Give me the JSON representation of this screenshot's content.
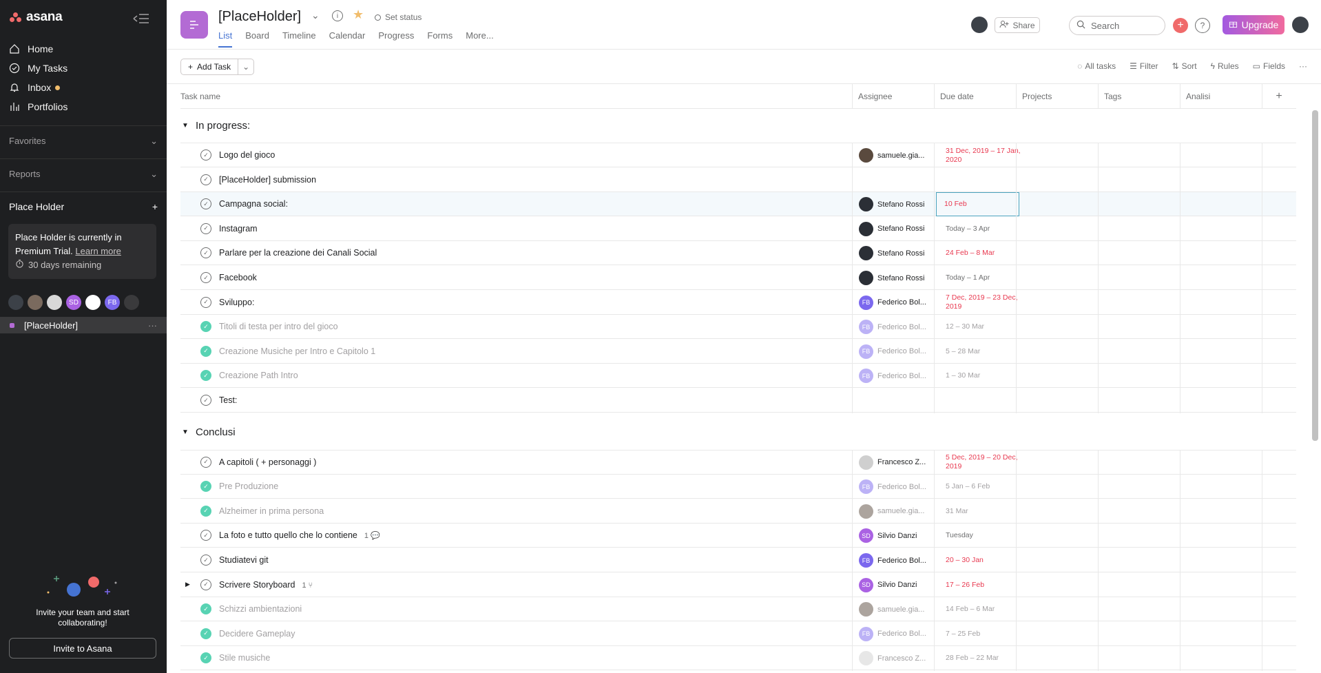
{
  "sidebar": {
    "logo_text": "asana",
    "nav": [
      {
        "label": "Home",
        "icon": "home-icon"
      },
      {
        "label": "My Tasks",
        "icon": "check-circle-icon"
      },
      {
        "label": "Inbox",
        "icon": "bell-icon"
      },
      {
        "label": "Portfolios",
        "icon": "bar-chart-icon"
      }
    ],
    "favorites_label": "Favorites",
    "reports_label": "Reports",
    "team_name": "Place Holder",
    "trial_text": "Place Holder is currently in Premium Trial.",
    "learn_more": "Learn more",
    "days_remaining": "30 days remaining",
    "members": [
      {
        "initials": "",
        "color": "#3c4148"
      },
      {
        "initials": "",
        "color": "#7a6a5e"
      },
      {
        "initials": "",
        "color": "#d8d8d8"
      },
      {
        "initials": "SD",
        "color": "#aa62e3"
      },
      {
        "initials": "",
        "color": "#ffffff"
      },
      {
        "initials": "FB",
        "color": "#7b68ee"
      },
      {
        "initials": "",
        "color": "#3a3a3c"
      }
    ],
    "project_name": "[PlaceHolder]",
    "project_more": "···",
    "invite_text_line1": "Invite your team and start",
    "invite_text_line2": "collaborating!",
    "invite_button": "Invite to Asana"
  },
  "header": {
    "project_title": "[PlaceHolder]",
    "set_status": "Set status",
    "tabs": [
      "List",
      "Board",
      "Timeline",
      "Calendar",
      "Progress",
      "Forms",
      "More..."
    ],
    "active_tab": "List",
    "share_label": "Share",
    "search_placeholder": "Search",
    "help_label": "?",
    "upgrade_label": "Upgrade"
  },
  "toolbar": {
    "add_task_label": "Add Task",
    "all_tasks_label": "All tasks",
    "filter_label": "Filter",
    "sort_label": "Sort",
    "rules_label": "Rules",
    "fields_label": "Fields",
    "more_label": "···"
  },
  "columns": [
    "Task name",
    "Assignee",
    "Due date",
    "Projects",
    "Tags",
    "Analisi"
  ],
  "add_column_label": "+",
  "sections": [
    {
      "title": "In progress:",
      "tasks": [
        {
          "name": "Logo del gioco",
          "done": false,
          "assignee": "samuele.gia...",
          "initials": "",
          "av_color": "#5a4a3e",
          "due": "31 Dec, 2019 – 17 Jan, 2020",
          "due_red": true
        },
        {
          "name": "[PlaceHolder] submission",
          "done": false,
          "assignee": "",
          "initials": "",
          "av_color": "",
          "due": "",
          "due_red": false
        },
        {
          "name": "Campagna social:",
          "done": false,
          "assignee": "Stefano Rossi",
          "initials": "",
          "av_color": "#2b2f36",
          "due": "10 Feb",
          "due_red": true,
          "selected": true
        },
        {
          "name": "Instagram",
          "done": false,
          "assignee": "Stefano Rossi",
          "initials": "",
          "av_color": "#2b2f36",
          "due": "Today – 3 Apr",
          "due_red": false
        },
        {
          "name": "Parlare per la creazione dei Canali Social",
          "done": false,
          "assignee": "Stefano Rossi",
          "initials": "",
          "av_color": "#2b2f36",
          "due": "24 Feb – 8 Mar",
          "due_red": true
        },
        {
          "name": "Facebook",
          "done": false,
          "assignee": "Stefano Rossi",
          "initials": "",
          "av_color": "#2b2f36",
          "due": "Today – 1 Apr",
          "due_red": false
        },
        {
          "name": "Sviluppo:",
          "done": false,
          "assignee": "Federico Bol...",
          "initials": "FB",
          "av_color": "#7b68ee",
          "due": "7 Dec, 2019 – 23 Dec, 2019",
          "due_red": true
        },
        {
          "name": "Titoli di testa per intro del gioco",
          "done": true,
          "assignee": "Federico Bol...",
          "initials": "FB",
          "av_color": "#7b68ee",
          "due": "12 – 30 Mar",
          "due_red": false
        },
        {
          "name": "Creazione Musiche per Intro e Capitolo 1",
          "done": true,
          "assignee": "Federico Bol...",
          "initials": "FB",
          "av_color": "#7b68ee",
          "due": "5 – 28 Mar",
          "due_red": false
        },
        {
          "name": "Creazione Path Intro",
          "done": true,
          "assignee": "Federico Bol...",
          "initials": "FB",
          "av_color": "#7b68ee",
          "due": "1 – 30 Mar",
          "due_red": false
        },
        {
          "name": "Test:",
          "done": false,
          "assignee": "",
          "initials": "",
          "av_color": "",
          "due": "",
          "due_red": false
        }
      ]
    },
    {
      "title": "Conclusi",
      "tasks": [
        {
          "name": "A capitoli ( + personaggi )",
          "done": false,
          "assignee": "Francesco Z...",
          "initials": "",
          "av_color": "#cfcfcf",
          "due": "5 Dec, 2019 – 20 Dec, 2019",
          "due_red": true
        },
        {
          "name": "Pre Produzione",
          "done": true,
          "assignee": "Federico Bol...",
          "initials": "FB",
          "av_color": "#7b68ee",
          "due": "5 Jan – 6 Feb",
          "due_red": false
        },
        {
          "name": "Alzheimer in prima persona",
          "done": true,
          "assignee": "samuele.gia...",
          "initials": "",
          "av_color": "#5a4a3e",
          "due": "31 Mar",
          "due_red": false
        },
        {
          "name": "La foto e tutto quello che lo contiene",
          "done": false,
          "meta": "1 💬",
          "assignee": "Silvio Danzi",
          "initials": "SD",
          "av_color": "#aa62e3",
          "due": "Tuesday",
          "due_red": false
        },
        {
          "name": "Studiatevi git",
          "done": false,
          "assignee": "Federico Bol...",
          "initials": "FB",
          "av_color": "#7b68ee",
          "due": "20 – 30 Jan",
          "due_red": true
        },
        {
          "name": "Scrivere Storyboard",
          "done": false,
          "meta": "1 ⑂",
          "expandable": true,
          "assignee": "Silvio Danzi",
          "initials": "SD",
          "av_color": "#aa62e3",
          "due": "17 – 26 Feb",
          "due_red": true
        },
        {
          "name": "Schizzi ambientazioni",
          "done": true,
          "assignee": "samuele.gia...",
          "initials": "",
          "av_color": "#5a4a3e",
          "due": "14 Feb – 6 Mar",
          "due_red": false
        },
        {
          "name": "Decidere Gameplay",
          "done": true,
          "assignee": "Federico Bol...",
          "initials": "FB",
          "av_color": "#7b68ee",
          "due": "7 – 25 Feb",
          "due_red": false
        },
        {
          "name": "Stile musiche",
          "done": true,
          "assignee": "Francesco Z...",
          "initials": "",
          "av_color": "#cfcfcf",
          "due": "28 Feb – 22 Mar",
          "due_red": false
        }
      ]
    }
  ]
}
